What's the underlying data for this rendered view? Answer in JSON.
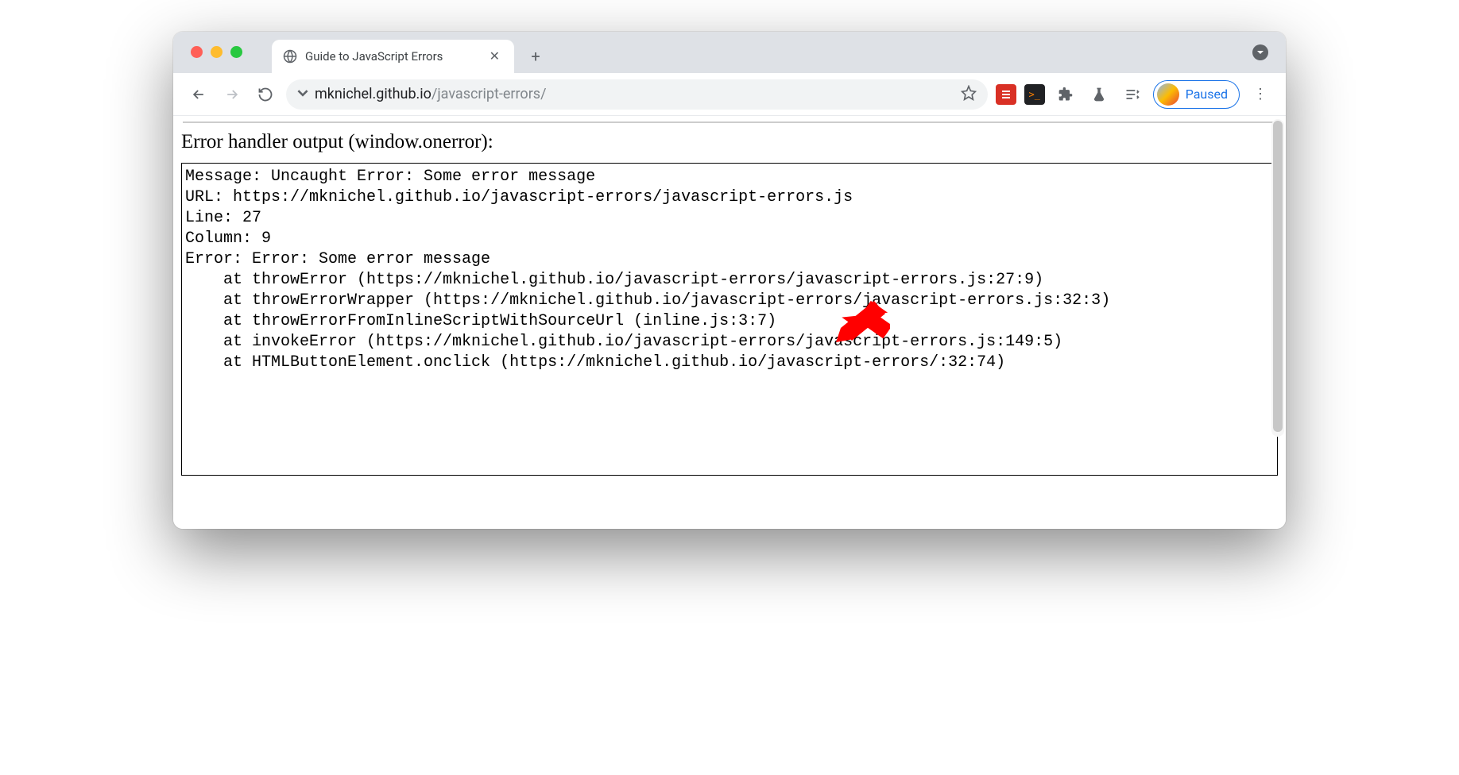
{
  "browser": {
    "tab_title": "Guide to JavaScript Errors",
    "url_host": "mknichel.github.io",
    "url_path": "/javascript-errors/",
    "profile_status": "Paused"
  },
  "page": {
    "section_title": "Error handler output (window.onerror):",
    "output": "Message: Uncaught Error: Some error message\nURL: https://mknichel.github.io/javascript-errors/javascript-errors.js\nLine: 27\nColumn: 9\nError: Error: Some error message\n    at throwError (https://mknichel.github.io/javascript-errors/javascript-errors.js:27:9)\n    at throwErrorWrapper (https://mknichel.github.io/javascript-errors/javascript-errors.js:32:3)\n    at throwErrorFromInlineScriptWithSourceUrl (inline.js:3:7)\n    at invokeError (https://mknichel.github.io/javascript-errors/javascript-errors.js:149:5)\n    at HTMLButtonElement.onclick (https://mknichel.github.io/javascript-errors/:32:74)"
  }
}
